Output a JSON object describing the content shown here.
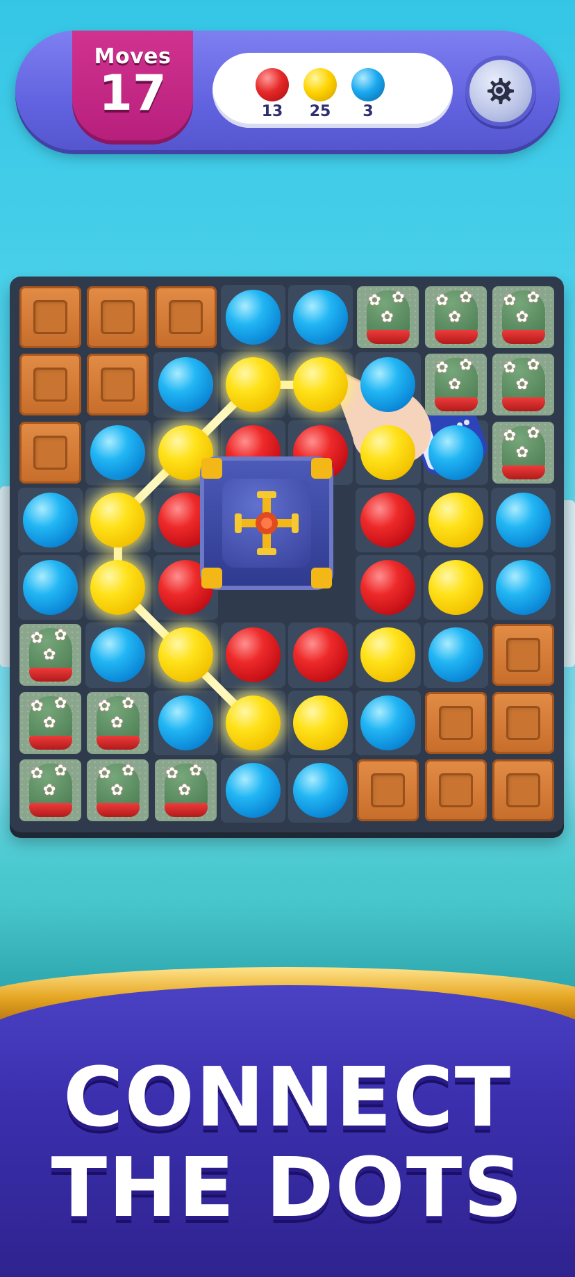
{
  "hud": {
    "moves_label": "Moves",
    "moves_value": "17",
    "goals": [
      {
        "color_name": "red",
        "color": "#e62828",
        "count": "13"
      },
      {
        "color_name": "yellow",
        "color": "#ffd400",
        "count": "25"
      },
      {
        "color_name": "blue",
        "color": "#1aa9ef",
        "count": "3"
      }
    ],
    "settings_icon": "gear-icon"
  },
  "board": {
    "rows": 8,
    "cols": 8,
    "legend": {
      "C": "wooden-crate",
      "P": "flower-cactus",
      "R": "red-dot",
      "Y": "yellow-dot",
      "B": "blue-dot",
      "X": "pipe-blocker",
      "H": "hidden"
    },
    "tiles": [
      [
        "C",
        "C",
        "C",
        "B",
        "B",
        "P",
        "P",
        "P"
      ],
      [
        "C",
        "C",
        "B",
        "Y",
        "Y",
        "B",
        "P",
        "P"
      ],
      [
        "C",
        "B",
        "Y",
        "R",
        "R",
        "Y",
        "B",
        "P"
      ],
      [
        "B",
        "Y",
        "R",
        "X",
        "X",
        "R",
        "Y",
        "B"
      ],
      [
        "B",
        "Y",
        "R",
        "X",
        "X",
        "R",
        "Y",
        "B"
      ],
      [
        "P",
        "B",
        "Y",
        "R",
        "R",
        "Y",
        "B",
        "C"
      ],
      [
        "P",
        "P",
        "B",
        "Y",
        "Y",
        "B",
        "C",
        "C"
      ],
      [
        "P",
        "P",
        "P",
        "B",
        "B",
        "C",
        "C",
        "C"
      ]
    ],
    "connected_path": [
      [
        1,
        4
      ],
      [
        1,
        3
      ],
      [
        2,
        2
      ],
      [
        3,
        1
      ],
      [
        4,
        1
      ],
      [
        5,
        2
      ],
      [
        6,
        3
      ]
    ],
    "tutorial_hand_icon": "pointing-hand-icon"
  },
  "banner": {
    "line1": "CONNECT",
    "line2": "THE DOTS"
  },
  "colors": {
    "hud_purple": "#6566e2",
    "moves_magenta": "#c42a85",
    "banner_purple": "#3b2fae",
    "banner_gold": "#e5a623"
  }
}
